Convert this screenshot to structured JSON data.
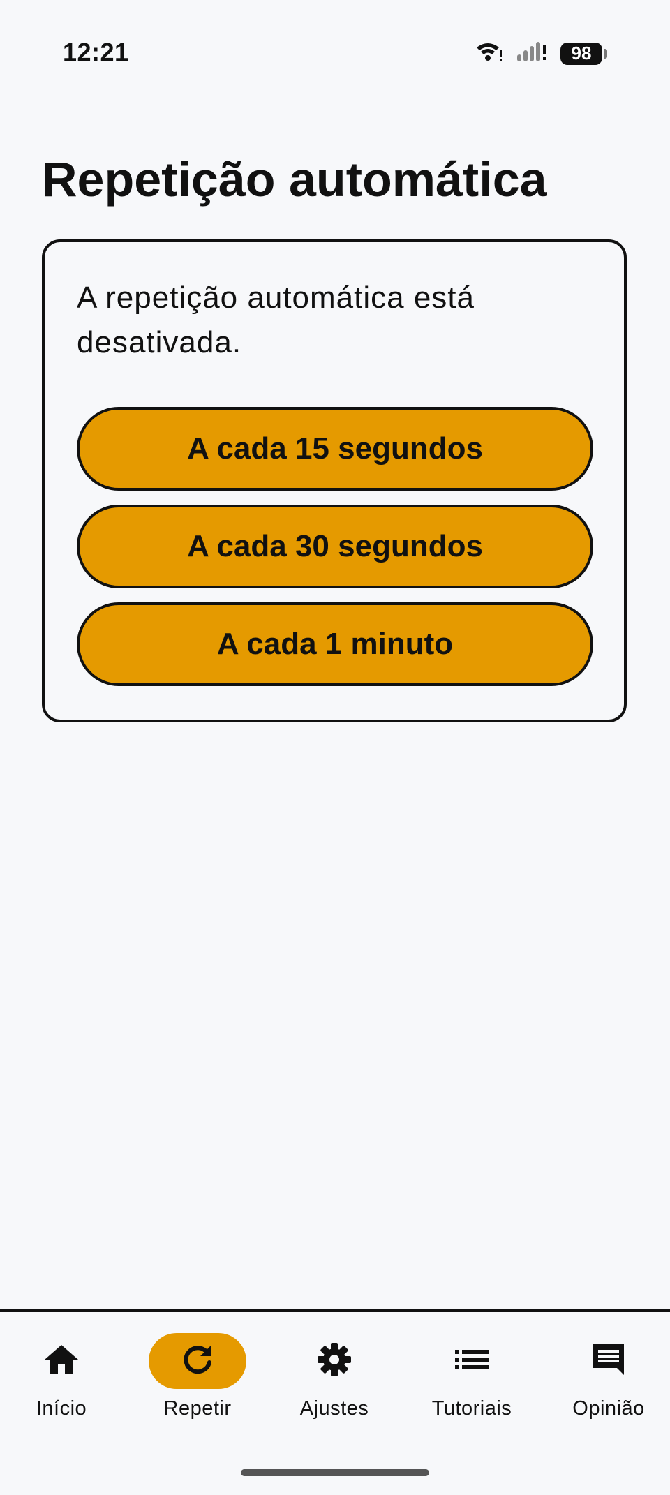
{
  "status_bar": {
    "time": "12:21",
    "battery": "98",
    "icons": [
      "wifi-icon",
      "signal-icon",
      "battery-icon"
    ]
  },
  "page": {
    "title": "Repetição automática"
  },
  "card": {
    "status_text": "A repetição automática está desativada.",
    "options": [
      {
        "label": "A cada 15 segundos"
      },
      {
        "label": "A cada 30 segundos"
      },
      {
        "label": "A cada 1 minuto"
      }
    ]
  },
  "bottom_nav": {
    "active": "Repetir",
    "items": [
      {
        "label": "Início",
        "icon": "home-icon"
      },
      {
        "label": "Repetir",
        "icon": "refresh-icon"
      },
      {
        "label": "Ajustes",
        "icon": "gear-icon"
      },
      {
        "label": "Tutoriais",
        "icon": "list-icon"
      },
      {
        "label": "Opinião",
        "icon": "feedback-icon"
      }
    ]
  },
  "colors": {
    "accent": "#e59a00",
    "background": "#f7f8fa",
    "text": "#111111"
  }
}
